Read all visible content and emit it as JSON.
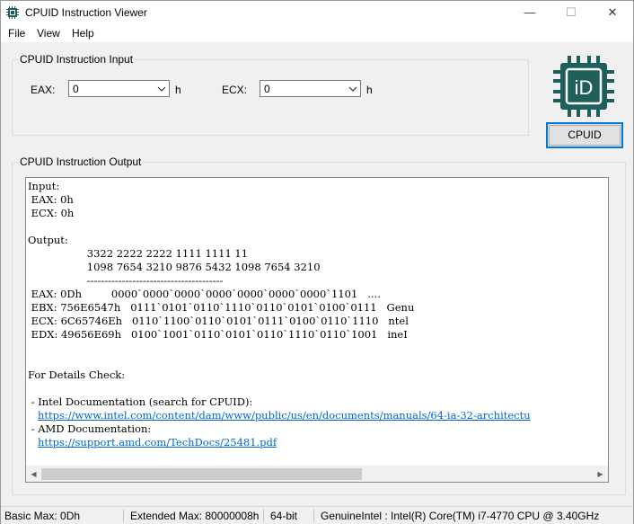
{
  "window": {
    "title": "CPUID Instruction Viewer",
    "minimize": "—",
    "maximize": "☐",
    "close": "✕"
  },
  "menu": [
    "File",
    "View",
    "Help"
  ],
  "input_group": {
    "legend": "CPUID Instruction Input",
    "eax_label": "EAX:",
    "eax_value": "0",
    "eax_suffix": "h",
    "ecx_label": "ECX:",
    "ecx_value": "0",
    "ecx_suffix": "h"
  },
  "logo": {
    "text": "iD",
    "color": "#1e5f5b"
  },
  "cpuid_button": "CPUID",
  "output_group": {
    "legend": "CPUID Instruction Output",
    "lines": [
      "Input:",
      " EAX: 0h",
      " ECX: 0h",
      "",
      "Output:",
      "                  3322 2222 2222 1111 1111 11",
      "                  1098 7654 3210 9876 5432 1098 7654 3210",
      "                  ---------------------------------------",
      " EAX: 0Dh         0000`0000`0000`0000`0000`0000`0000`1101   ....",
      " EBX: 756E6547h   0111`0101`0110`1110`0110`0101`0100`0111   Genu",
      " ECX: 6C65746Eh   0110`1100`0110`0101`0111`0100`0110`1110   ntel",
      " EDX: 49656E69h   0100`1001`0110`0101`0110`1110`0110`1001   ineI",
      "",
      "",
      "For Details Check:",
      "",
      " - Intel Documentation (search for CPUID):"
    ],
    "intel_link": "https://www.intel.com/content/dam/www/public/us/en/documents/manuals/64-ia-32-architectu",
    "amd_label": " - AMD Documentation:",
    "amd_link": "https://support.amd.com/TechDocs/25481.pdf"
  },
  "status": {
    "basic_max": "Basic Max: 0Dh",
    "extended_max": "Extended Max: 80000008h",
    "bitness": "64-bit",
    "cpu": "GenuineIntel : Intel(R) Core(TM) i7-4770 CPU @ 3.40GHz"
  }
}
